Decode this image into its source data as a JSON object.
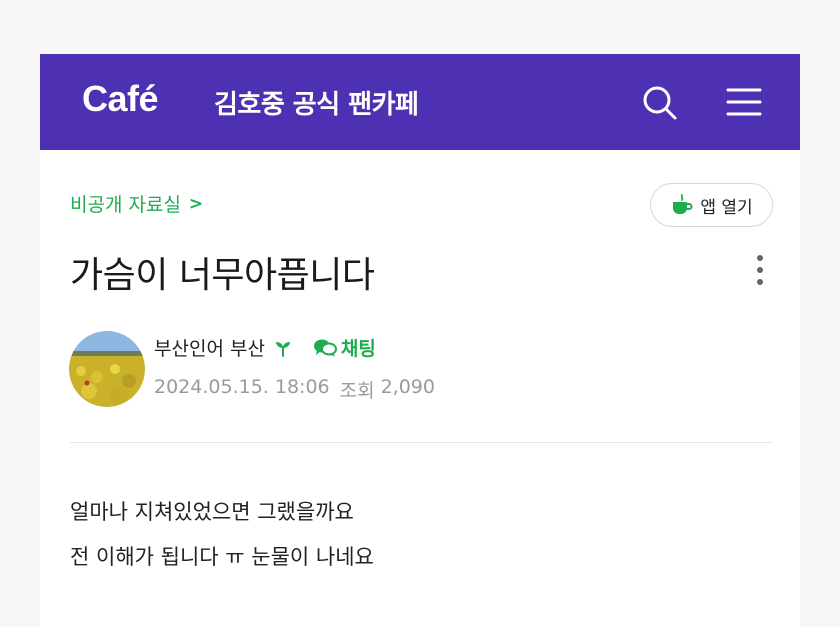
{
  "header": {
    "logo": "Café",
    "cafe_name": "김호중 공식 팬카페",
    "bg_color": "#4d31b2",
    "search_icon": "search-icon",
    "menu_icon": "hamburger-menu-icon"
  },
  "post": {
    "category": "비공개 자료실",
    "category_chevron": ">",
    "app_open_label": "앱 열기",
    "title": "가슴이 너무아픕니다",
    "author": "부산인어 부산",
    "chat_label": "채팅",
    "date": "2024.05.15. 18:06",
    "views_label": "조회",
    "views": "2,090",
    "body": [
      "얼마나 지쳐있었으면 그랬을까요",
      "전 이해가 됩니다 ㅠ 눈물이 나네요"
    ]
  },
  "colors": {
    "accent_green": "#1dad4f",
    "brand_purple": "#4d31b2"
  }
}
